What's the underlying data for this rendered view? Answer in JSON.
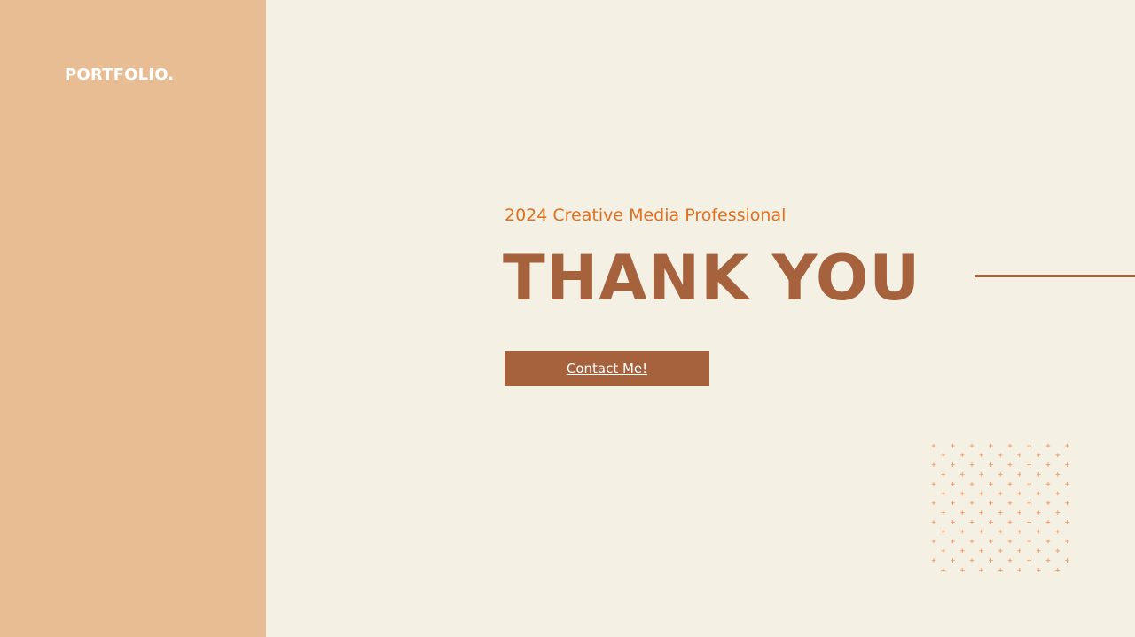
{
  "brand": {
    "label": "PORTFOLIO."
  },
  "hero": {
    "subtitle": "2024 Creative Media Professional",
    "headline": "THANK YOU"
  },
  "cta": {
    "label": "Contact Me!"
  },
  "decoration": {
    "pattern_icon": "cross-dot-pattern-icon",
    "pattern_color": "#f0a070"
  },
  "colors": {
    "background": "#f5f0e4",
    "sidebar": "#e8bd94",
    "accent_brown": "#a6623d",
    "accent_orange": "#e0701e"
  }
}
